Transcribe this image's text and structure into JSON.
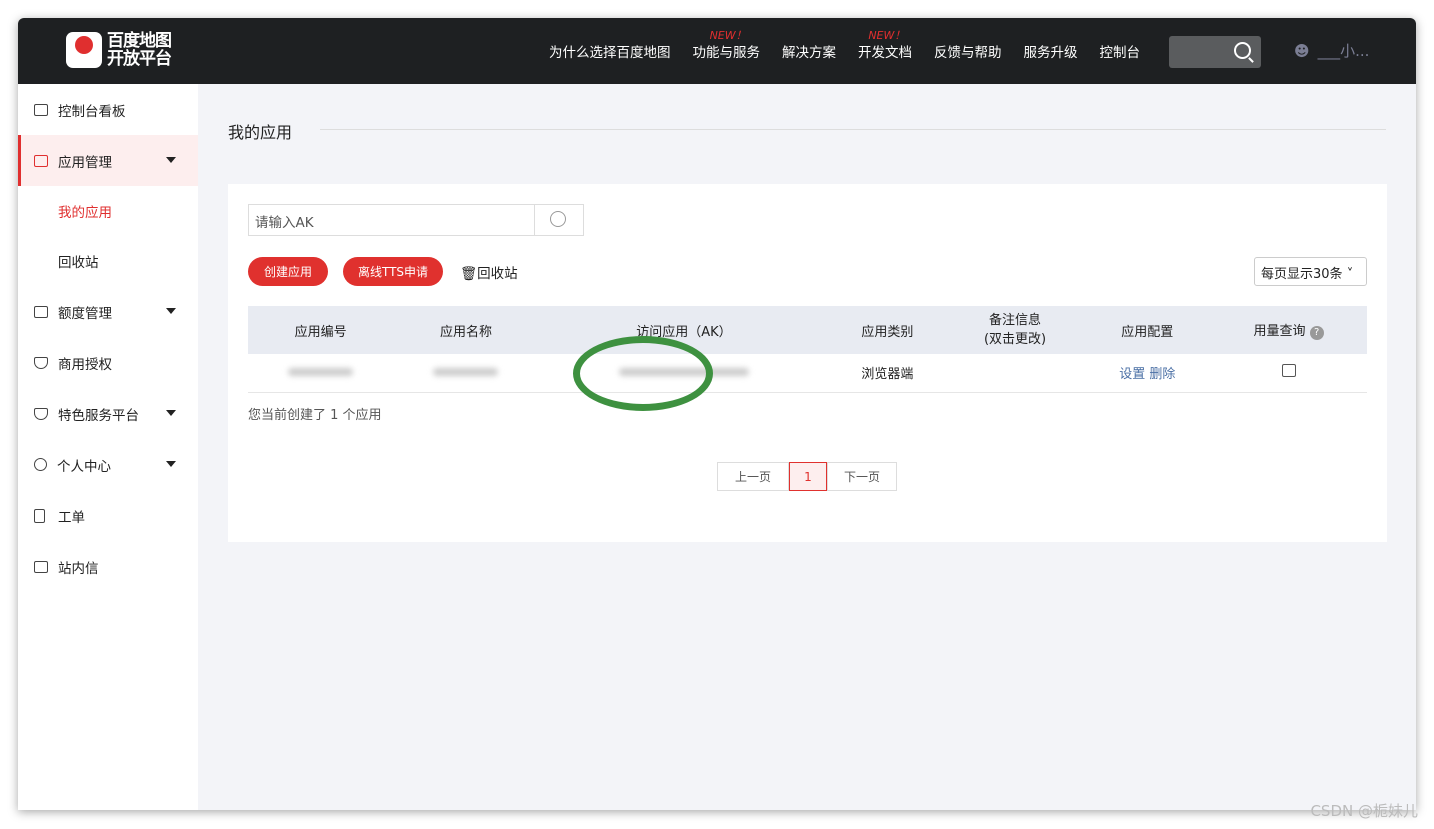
{
  "header": {
    "logo_line1": "百度地图",
    "logo_line2": "开放平台",
    "logo_pin": "du",
    "nav": [
      {
        "label": "为什么选择百度地图"
      },
      {
        "label": "功能与服务",
        "badge": "NEW！"
      },
      {
        "label": "解决方案"
      },
      {
        "label": "开发文档",
        "badge": "NEW！"
      },
      {
        "label": "反馈与帮助"
      },
      {
        "label": "服务升级"
      },
      {
        "label": "控制台"
      }
    ],
    "user": "___小..."
  },
  "sidebar": {
    "items": [
      {
        "label": "控制台看板"
      },
      {
        "label": "应用管理"
      },
      {
        "label": "我的应用"
      },
      {
        "label": "回收站"
      },
      {
        "label": "额度管理"
      },
      {
        "label": "商用授权"
      },
      {
        "label": "特色服务平台"
      },
      {
        "label": "个人中心"
      },
      {
        "label": "工单"
      },
      {
        "label": "站内信"
      }
    ]
  },
  "main": {
    "title": "我的应用",
    "search_placeholder": "请输入AK",
    "create_btn": "创建应用",
    "tts_btn": "离线TTS申请",
    "recycle": "回收站",
    "page_size": "每页显示30条",
    "columns": [
      "应用编号",
      "应用名称",
      "访问应用（AK）",
      "应用类别",
      "备注信息\n(双击更改)",
      "应用配置",
      "用量查询"
    ],
    "rows": [
      {
        "type": "浏览器端",
        "config_set": "设置",
        "config_delete": "删除"
      }
    ],
    "count_text": "您当前创建了 1 个应用",
    "pagination": {
      "prev": "上一页",
      "current": "1",
      "next": "下一页"
    }
  },
  "watermark": "CSDN @栀妹儿",
  "colors": {
    "accent": "#e0312e",
    "header": "#1e2022",
    "annotation": "#3e9140"
  }
}
